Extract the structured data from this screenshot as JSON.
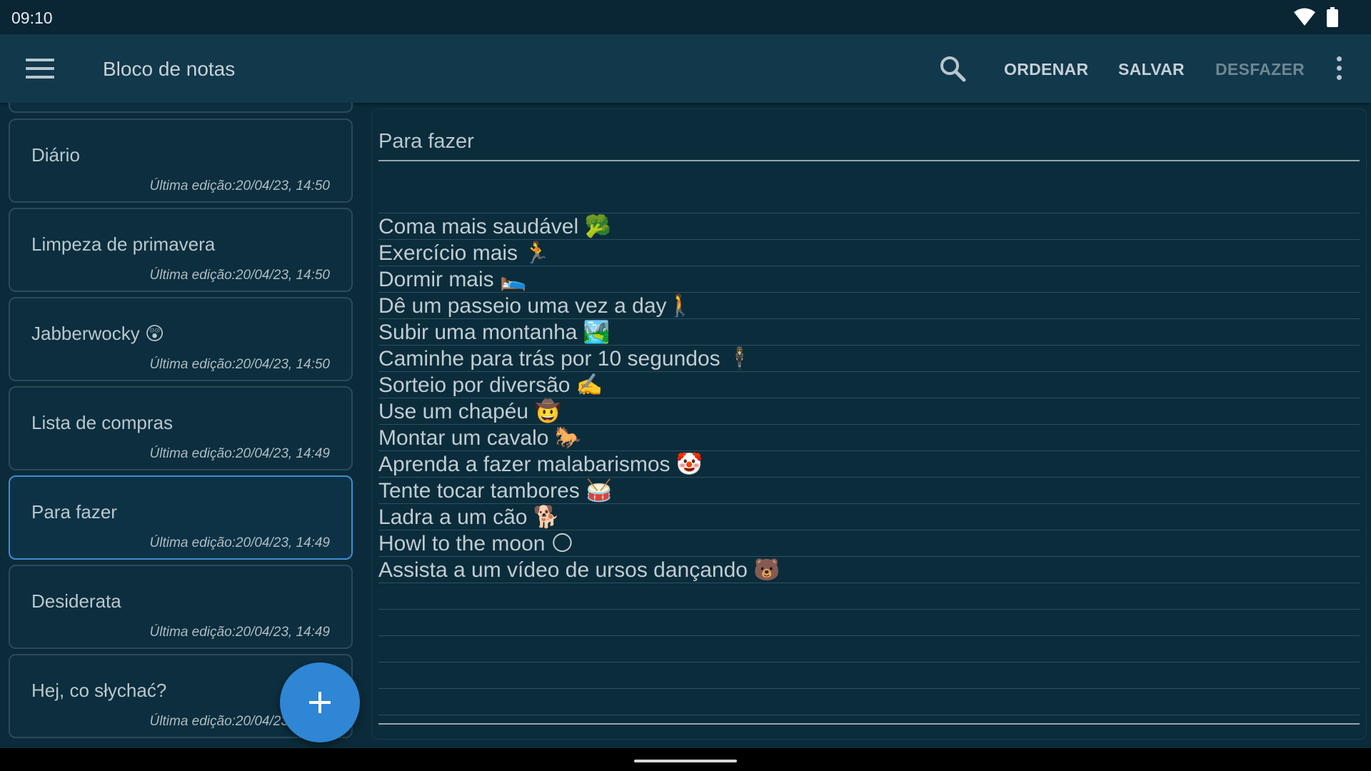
{
  "status_bar": {
    "time": "09:10",
    "icons": [
      "wifi-icon",
      "battery-icon"
    ]
  },
  "app_bar": {
    "title": "Bloco de notas",
    "actions": {
      "sort": "ORDENAR",
      "save": "SALVAR",
      "undo": "DESFAZER"
    },
    "icons": [
      "menu-icon",
      "search-icon",
      "more-vert-icon"
    ]
  },
  "notes": [
    {
      "title": "Diário",
      "date": "Última edição:20/04/23, 14:50",
      "selected": false
    },
    {
      "title": "Limpeza de primavera",
      "date": "Última edição:20/04/23, 14:50",
      "selected": false
    },
    {
      "title": "Jabberwocky 😲",
      "date": "Última edição:20/04/23, 14:50",
      "selected": false
    },
    {
      "title": "Lista de compras",
      "date": "Última edição:20/04/23, 14:49",
      "selected": false
    },
    {
      "title": "Para fazer",
      "date": "Última edição:20/04/23, 14:49",
      "selected": true
    },
    {
      "title": "Desiderata",
      "date": "Última edição:20/04/23, 14:49",
      "selected": false
    },
    {
      "title": "Hej, co słychać?",
      "date": "Última edição:20/04/23, 14:49",
      "selected": false
    }
  ],
  "editor": {
    "title": "Para fazer",
    "lines": [
      "",
      "Coma mais saudável 🥦",
      "Exercício mais 🏃",
      "Dormir mais 🛌",
      "Dê um passeio uma vez a day🚶",
      "Subir uma montanha 🏞️",
      "Caminhe para trás por 10 segundos 🕴",
      "Sorteio por diversão ✍️",
      "Use um chapéu 🤠",
      "Montar um cavalo 🐎",
      "Aprenda a fazer malabarismos 🤡",
      "Tente tocar tambores 🥁",
      "Ladra a um cão 🐕",
      "Howl to the moon 🌕",
      "Assista a um vídeo de ursos dançando 🐻"
    ]
  },
  "fab": {
    "icon": "add-icon"
  },
  "colors": {
    "app_bar": "#12384b",
    "background": "#0b2b3a",
    "accent": "#2e86d4",
    "selected_border": "#3d8ed2"
  }
}
